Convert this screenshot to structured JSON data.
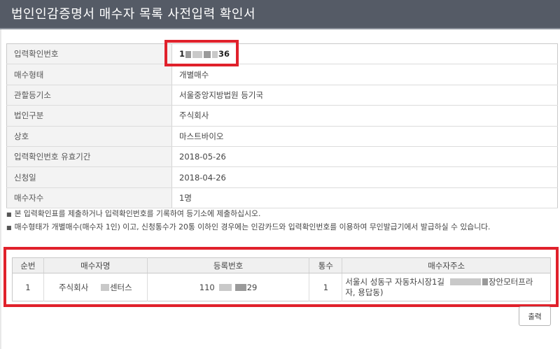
{
  "header": {
    "title": "법인인감증명서 매수자 목록 사전입력 확인서"
  },
  "info_rows": [
    {
      "label": "입력확인번호",
      "value": "36",
      "value_prefix": "1"
    },
    {
      "label": "매수형태",
      "value": "개별매수"
    },
    {
      "label": "관할등기소",
      "value": "서울중앙지방법원 등기국"
    },
    {
      "label": "법인구분",
      "value": "주식회사"
    },
    {
      "label": "상호",
      "value": "마스트바이오"
    },
    {
      "label": "입력확인번호 유효기간",
      "value": "2018-05-26"
    },
    {
      "label": "신청일",
      "value": "2018-04-26"
    },
    {
      "label": "매수자수",
      "value": "1명"
    }
  ],
  "notes": [
    "본 입력확인표를 제출하거나 입력확인번호를 기록하여 등기소에 제출하십시오.",
    "매수형태가 개별매수(매수자 1인) 이고, 신청통수가 20통 이하인 경우에는 인감카드와 입력확인번호를 이용하여 무인발급기에서 발급하실 수 있습니다."
  ],
  "buyer_table": {
    "headers": [
      "순번",
      "매수자명",
      "등록번호",
      "통수",
      "매수자주소"
    ],
    "rows": [
      {
        "seq": "1",
        "name_prefix": "주식회사",
        "name_suffix": "센터스",
        "reg_prefix": "110",
        "reg_suffix": "29",
        "count": "1",
        "addr_line1_prefix": "서울시 성동구 자동차시장1길",
        "addr_line1_suffix": "장안모터프라",
        "addr_line2": "자, 용답동)"
      }
    ]
  },
  "actions": {
    "print_label": "출력"
  },
  "colors": {
    "title_bg": "#555b66",
    "highlight": "#e0212b"
  }
}
